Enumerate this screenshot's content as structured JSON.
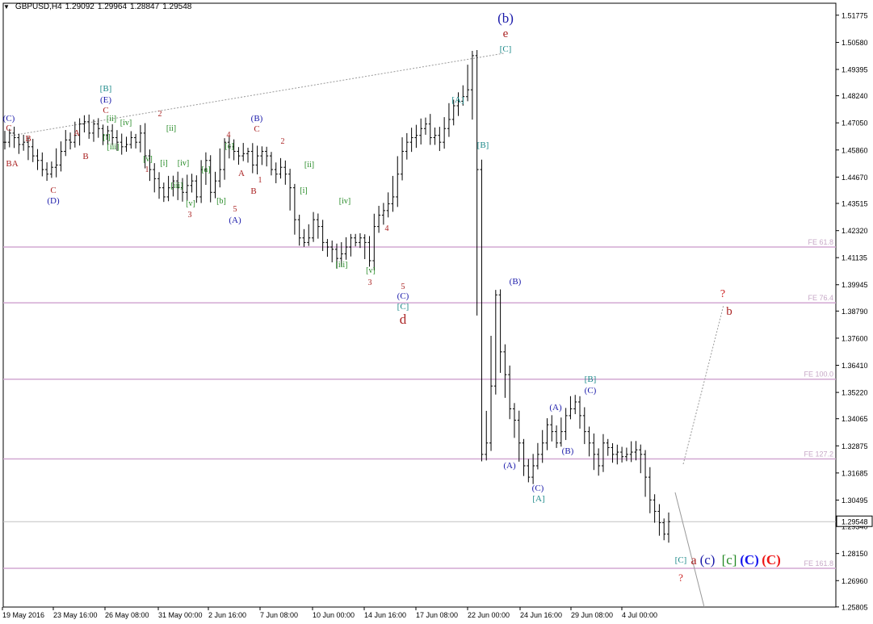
{
  "header": {
    "symbol": "GBPUSD,H4",
    "open": "1.29092",
    "high": "1.29964",
    "low": "1.28847",
    "close": "1.29548"
  },
  "chart_data": {
    "type": "ohlc",
    "title": "GBPUSD,H4",
    "ylim": [
      1.258,
      1.523
    ],
    "grid": false,
    "y_ticks": [
      "1.51775",
      "1.50580",
      "1.49395",
      "1.48240",
      "1.47050",
      "1.45860",
      "1.44670",
      "1.43515",
      "1.42320",
      "1.41135",
      "1.39945",
      "1.38790",
      "1.37600",
      "1.36410",
      "1.35220",
      "1.34065",
      "1.32875",
      "1.31685",
      "1.30495",
      "1.29340",
      "1.28150",
      "1.26960",
      "1.25805"
    ],
    "y_tick_values": [
      1.51775,
      1.5058,
      1.49395,
      1.4824,
      1.4705,
      1.4586,
      1.4467,
      1.43515,
      1.4232,
      1.41135,
      1.39945,
      1.3879,
      1.376,
      1.3641,
      1.3522,
      1.34065,
      1.32875,
      1.31685,
      1.30495,
      1.2934,
      1.2815,
      1.2696,
      1.25805
    ],
    "x_labels": [
      "19 May 2016",
      "23 May 16:00",
      "26 May 08:00",
      "31 May 00:00",
      "2 Jun 16:00",
      "7 Jun 08:00",
      "10 Jun 00:00",
      "14 Jun 16:00",
      "17 Jun 08:00",
      "22 Jun 00:00",
      "24 Jun 16:00",
      "29 Jun 08:00",
      "4 Jul 00:00"
    ],
    "current_price": {
      "label": "1.29548",
      "value": 1.29548
    },
    "fe_levels": [
      {
        "label": "FE 61.8",
        "value": 1.416
      },
      {
        "label": "FE 76.4",
        "value": 1.3915
      },
      {
        "label": "FE 100.0",
        "value": 1.358
      },
      {
        "label": "FE 127.2",
        "value": 1.323
      },
      {
        "label": "FE 161.8",
        "value": 1.275
      }
    ],
    "price_path": [
      1.462,
      1.466,
      1.464,
      1.461,
      1.462,
      1.46,
      1.456,
      1.454,
      1.45,
      1.448,
      1.451,
      1.452,
      1.458,
      1.463,
      1.462,
      1.465,
      1.47,
      1.471,
      1.466,
      1.47,
      1.468,
      1.465,
      1.467,
      1.464,
      1.462,
      1.46,
      1.461,
      1.464,
      1.462,
      1.466,
      1.456,
      1.45,
      1.446,
      1.442,
      1.438,
      1.442,
      1.445,
      1.442,
      1.44,
      1.443,
      1.445,
      1.438,
      1.45,
      1.454,
      1.44,
      1.445,
      1.45,
      1.462,
      1.46,
      1.458,
      1.456,
      1.457,
      1.458,
      1.452,
      1.456,
      1.458,
      1.456,
      1.45,
      1.448,
      1.451,
      1.448,
      1.442,
      1.428,
      1.42,
      1.418,
      1.42,
      1.428,
      1.425,
      1.418,
      1.416,
      1.415,
      1.411,
      1.413,
      1.416,
      1.42,
      1.418,
      1.42,
      1.418,
      1.41,
      1.425,
      1.43,
      1.432,
      1.435,
      1.438,
      1.448,
      1.458,
      1.462,
      1.464,
      1.465,
      1.468,
      1.47,
      1.464,
      1.465,
      1.462,
      1.468,
      1.472,
      1.478,
      1.48,
      1.482,
      1.485,
      1.5,
      1.45,
      1.325,
      1.33,
      1.355,
      1.395,
      1.37,
      1.36,
      1.345,
      1.34,
      1.33,
      1.32,
      1.315,
      1.32,
      1.325,
      1.33,
      1.338,
      1.335,
      1.33,
      1.335,
      1.342,
      1.345,
      1.348,
      1.342,
      1.335,
      1.33,
      1.325,
      1.32,
      1.33,
      1.328,
      1.325,
      1.326,
      1.324,
      1.325,
      1.326,
      1.327,
      1.325,
      1.315,
      1.305,
      1.3,
      1.295,
      1.29,
      1.2955
    ],
    "labels": [
      {
        "t": "(b)",
        "c": "#1a1aaa",
        "s": 17
      },
      {
        "t": "e",
        "c": "#aa2222",
        "s": 15
      },
      {
        "t": "[C]",
        "c": "#1e8a8a",
        "s": 11
      },
      {
        "t": "[A]",
        "c": "#1e8a8a",
        "s": 11
      },
      {
        "t": "[B]",
        "c": "#1e8a8a",
        "s": 11
      },
      {
        "t": "[B]",
        "c": "#1e8a8a",
        "s": 11
      },
      {
        "t": "(E)",
        "c": "#1a1aaa",
        "s": 11
      },
      {
        "t": "C",
        "c": "#aa2222",
        "s": 11
      },
      {
        "t": "[ii]",
        "c": "#228822",
        "s": 10
      },
      {
        "t": "[iv]",
        "c": "#228822",
        "s": 10
      },
      {
        "t": "[i]",
        "c": "#228822",
        "s": 10
      },
      {
        "t": "[iii]",
        "c": "#228822",
        "s": 10
      },
      {
        "t": "[v]",
        "c": "#228822",
        "s": 10
      },
      {
        "t": "1",
        "c": "#aa2222",
        "s": 10
      },
      {
        "t": "2",
        "c": "#aa2222",
        "s": 10
      },
      {
        "t": "[ii]",
        "c": "#228822",
        "s": 10
      },
      {
        "t": "[i]",
        "c": "#228822",
        "s": 10
      },
      {
        "t": "[iv]",
        "c": "#228822",
        "s": 10
      },
      {
        "t": "[iii]",
        "c": "#228822",
        "s": 10
      },
      {
        "t": "[a]",
        "c": "#228822",
        "s": 10
      },
      {
        "t": "[v]",
        "c": "#228822",
        "s": 10
      },
      {
        "t": "3",
        "c": "#aa2222",
        "s": 10
      },
      {
        "t": "[b]",
        "c": "#228822",
        "s": 10
      },
      {
        "t": "(C)",
        "c": "#1a1aaa",
        "s": 11
      },
      {
        "t": "C",
        "c": "#aa2222",
        "s": 11
      },
      {
        "t": "B",
        "c": "#aa2222",
        "s": 11
      },
      {
        "t": "BA",
        "c": "#aa2222",
        "s": 11
      },
      {
        "t": "A",
        "c": "#aa2222",
        "s": 11
      },
      {
        "t": "B",
        "c": "#aa2222",
        "s": 11
      },
      {
        "t": "C",
        "c": "#aa2222",
        "s": 11
      },
      {
        "t": "(D)",
        "c": "#1a1aaa",
        "s": 11
      },
      {
        "t": "4",
        "c": "#aa2222",
        "s": 10
      },
      {
        "t": "[c]",
        "c": "#228822",
        "s": 10
      },
      {
        "t": "A",
        "c": "#aa2222",
        "s": 11
      },
      {
        "t": "B",
        "c": "#aa2222",
        "s": 11
      },
      {
        "t": "5",
        "c": "#aa2222",
        "s": 10
      },
      {
        "t": "(A)",
        "c": "#1a1aaa",
        "s": 11
      },
      {
        "t": "(B)",
        "c": "#1a1aaa",
        "s": 11
      },
      {
        "t": "C",
        "c": "#aa2222",
        "s": 11
      },
      {
        "t": "1",
        "c": "#aa2222",
        "s": 10
      },
      {
        "t": "2",
        "c": "#aa2222",
        "s": 10
      },
      {
        "t": "[ii]",
        "c": "#228822",
        "s": 10
      },
      {
        "t": "[i]",
        "c": "#228822",
        "s": 10
      },
      {
        "t": "[iv]",
        "c": "#228822",
        "s": 10
      },
      {
        "t": "[iii]",
        "c": "#228822",
        "s": 10
      },
      {
        "t": "[v]",
        "c": "#228822",
        "s": 10
      },
      {
        "t": "3",
        "c": "#aa2222",
        "s": 10
      },
      {
        "t": "4",
        "c": "#aa2222",
        "s": 10
      },
      {
        "t": "5",
        "c": "#aa2222",
        "s": 10
      },
      {
        "t": "(C)",
        "c": "#1a1aaa",
        "s": 11
      },
      {
        "t": "[C]",
        "c": "#1e8a8a",
        "s": 11
      },
      {
        "t": "d",
        "c": "#aa2222",
        "s": 17
      },
      {
        "t": "(B)",
        "c": "#1a1aaa",
        "s": 11
      },
      {
        "t": "(A)",
        "c": "#1a1aaa",
        "s": 11
      },
      {
        "t": "[B]",
        "c": "#1e8a8a",
        "s": 11
      },
      {
        "t": "(C)",
        "c": "#1a1aaa",
        "s": 11
      },
      {
        "t": "(A)",
        "c": "#1a1aaa",
        "s": 11
      },
      {
        "t": "(B)",
        "c": "#1a1aaa",
        "s": 11
      },
      {
        "t": "(C)",
        "c": "#1a1aaa",
        "s": 11
      },
      {
        "t": "[A]",
        "c": "#1e8a8a",
        "s": 11
      },
      {
        "t": "?",
        "c": "#cc2222",
        "s": 14
      },
      {
        "t": "b",
        "c": "#aa2222",
        "s": 15
      },
      {
        "t": "[C]",
        "c": "#1e8a8a",
        "s": 11
      },
      {
        "t": "a",
        "c": "#aa2222",
        "s": 16
      },
      {
        "t": "(c)",
        "c": "#1a1aaa",
        "s": 17
      },
      {
        "t": "[c]",
        "c": "#228822",
        "s": 17
      },
      {
        "t": "(C)",
        "c": "#1515ee",
        "s": 17
      },
      {
        "t": "(C)",
        "c": "#ee1515",
        "s": 17
      },
      {
        "t": "?",
        "c": "#cc2222",
        "s": 13
      }
    ]
  }
}
